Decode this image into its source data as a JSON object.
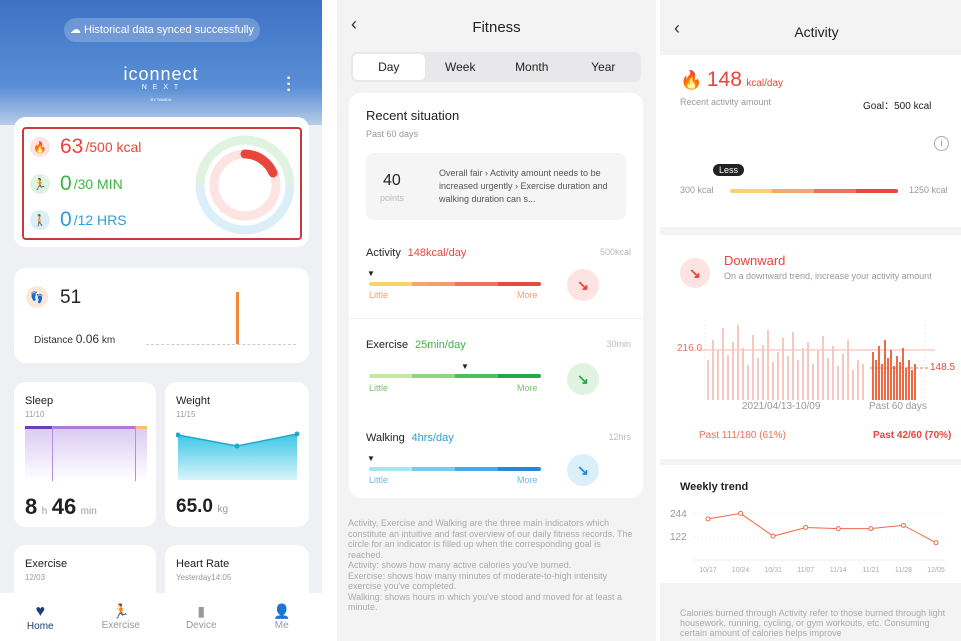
{
  "home": {
    "sync_toast": "Historical data synced successfully",
    "logo_main": "iconnect",
    "logo_next": "N E X T",
    "logo_by": "BY TAMIDA",
    "kcal_value": "63",
    "kcal_goal": "/500 kcal",
    "min_value": "0",
    "min_goal": "/30 MIN",
    "hrs_value": "0",
    "hrs_goal": "/12 HRS",
    "steps": "51",
    "distance_label": "Distance",
    "distance_value": "0.06",
    "distance_unit": "km",
    "sleep_title": "Sleep",
    "sleep_date": "11/10",
    "sleep_h": "8",
    "sleep_h_unit": "h",
    "sleep_m": "46",
    "sleep_m_unit": "min",
    "weight_title": "Weight",
    "weight_date": "11/15",
    "weight_value": "65.0",
    "weight_unit": "kg",
    "exercise_title": "Exercise",
    "exercise_date": "12/03",
    "hr_title": "Heart Rate",
    "hr_date": "Yesterday14:05",
    "tabs": [
      "Home",
      "Exercise",
      "Device",
      "Me"
    ],
    "colors": {
      "kcal": "#e9453b",
      "min": "#3cb543",
      "hrs": "#2a9fd8"
    }
  },
  "fitness": {
    "title": "Fitness",
    "segments": [
      "Day",
      "Week",
      "Month",
      "Year"
    ],
    "recent_title": "Recent situation",
    "recent_sub": "Past 60 days",
    "points": "40",
    "points_label": "points",
    "summary": "Overall fair › Activity amount needs to be increased urgently › Exercise duration and walking duration can s...",
    "activity_label": "Activity",
    "activity_value": "148kcal/day",
    "activity_goal": "500kcal",
    "exercise_label": "Exercise",
    "exercise_value": "25min/day",
    "exercise_goal": "30min",
    "walking_label": "Walking",
    "walking_value": "4hrs/day",
    "walking_goal": "12hrs",
    "little": "Little",
    "more": "More",
    "info_text": "Activity, Exercise and Walking are the three main indicators which constitute an intuitive and fast overview of our daily fitness records. The circle for an indicator is filled up when the corresponding goal is reached.\nActivity: shows how many active calories you've burned.\nExercise: shows how many minutes of moderate-to-high intensity exercise you've completed.\nWalking: shows hours in which you've stood and moved for at least a minute."
  },
  "activity": {
    "title": "Activity",
    "value": "148",
    "value_unit": "kcal/day",
    "recent_label": "Recent activity amount",
    "goal_text": "Goal：500 kcal",
    "less_tag": "Less",
    "range_low": "300 kcal",
    "range_high": "1250 kcal",
    "trend_title": "Downward",
    "trend_desc": "On a downward trend, increase your activity amount",
    "y_label_left": "216.0",
    "y_label_right": "148.5",
    "date_range": "2021/04/13-10/09",
    "past_60_label": "Past 60 days",
    "past_left": "Past 111/180 (61%)",
    "past_right": "Past 42/60 (70%)",
    "weekly_title": "Weekly trend",
    "weekly_y_top": "244",
    "weekly_y_mid": "122",
    "weekly_x": [
      "10/17",
      "10/24",
      "10/31",
      "11/07",
      "11/14",
      "11/21",
      "11/28",
      "12/05"
    ],
    "footer_text": "Calories burned through Activity refer to those burned through light housework, running, cycling, or gym workouts, etc. Consuming certain amount of calories helps improve"
  },
  "chart_data": [
    {
      "type": "line",
      "title": "Weekly trend",
      "categories": [
        "10/17",
        "10/24",
        "10/31",
        "11/07",
        "11/14",
        "11/21",
        "11/28",
        "12/05"
      ],
      "values": [
        190,
        215,
        110,
        150,
        145,
        145,
        160,
        80
      ],
      "ylim": [
        0,
        300
      ]
    }
  ]
}
